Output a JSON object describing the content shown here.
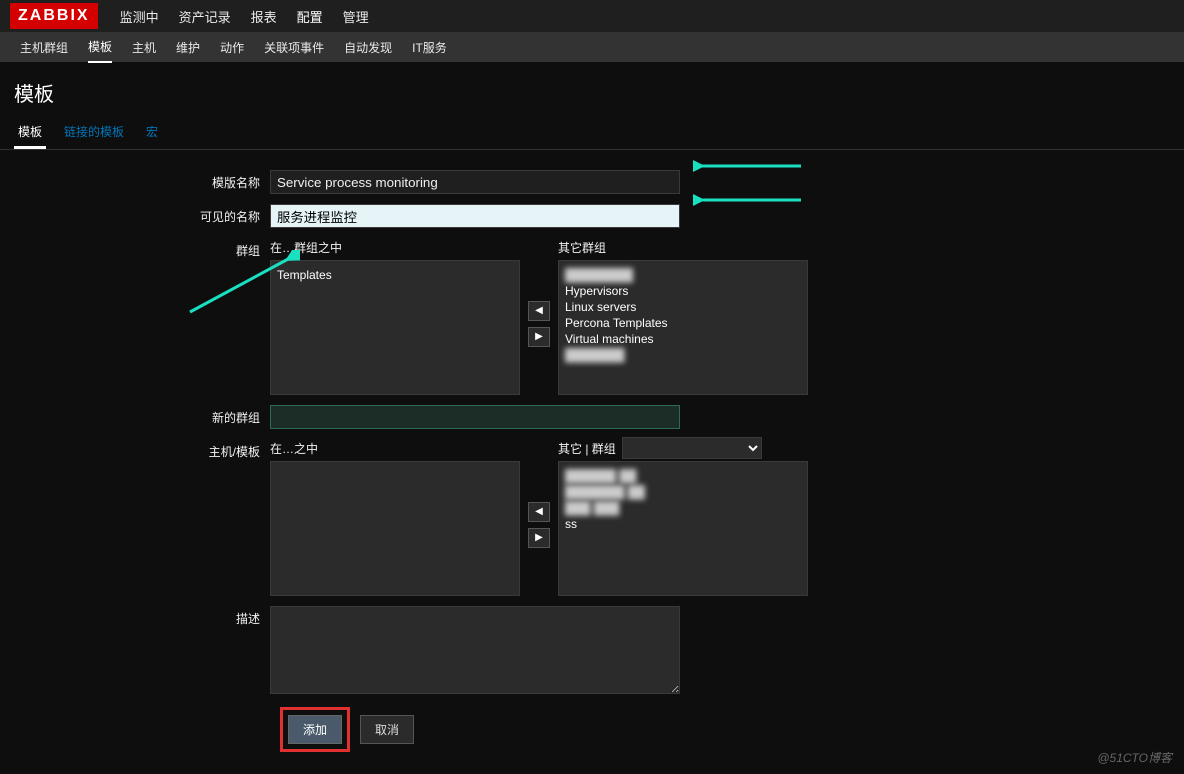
{
  "logo": "ZABBIX",
  "topnav": {
    "items": [
      "监测中",
      "资产记录",
      "报表",
      "配置",
      "管理"
    ],
    "active": 3
  },
  "subnav": {
    "items": [
      "主机群组",
      "模板",
      "主机",
      "维护",
      "动作",
      "关联项事件",
      "自动发现",
      "IT服务"
    ],
    "active": 1
  },
  "page_title": "模板",
  "tabs": {
    "items": [
      "模板",
      "链接的模板",
      "宏"
    ],
    "active": 0
  },
  "form": {
    "template_name": {
      "label": "模版名称",
      "value": "Service process monitoring"
    },
    "visible_name": {
      "label": "可见的名称",
      "value": "服务进程监控"
    },
    "groups": {
      "label": "群组",
      "in_label": "在…群组之中",
      "in_items": [
        "Templates"
      ],
      "other_label": "其它群组",
      "other_items": [
        "",
        "Hypervisors",
        "Linux servers",
        "Percona Templates",
        "Virtual machines",
        ""
      ]
    },
    "new_group": {
      "label": "新的群组",
      "value": ""
    },
    "hosts": {
      "label": "主机/模板",
      "in_label": "在…之中",
      "other_label": "其它 | 群组",
      "other_select": "",
      "other_items": [
        "",
        "",
        "",
        "ss"
      ]
    },
    "description": {
      "label": "描述",
      "value": ""
    }
  },
  "buttons": {
    "add": "添加",
    "cancel": "取消"
  },
  "move": {
    "left": "◀",
    "right": "▶"
  },
  "watermark": "@51CTO博客"
}
